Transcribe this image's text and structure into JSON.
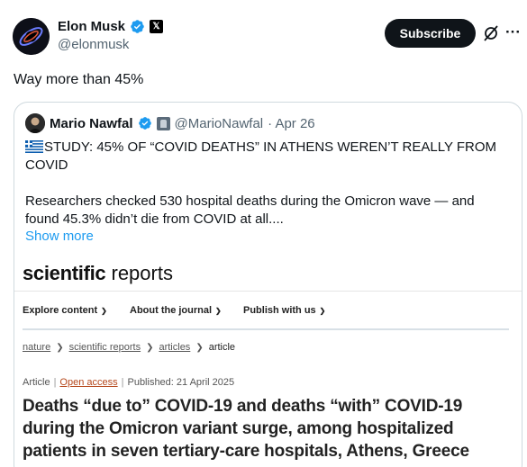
{
  "author": {
    "display_name": "Elon Musk",
    "handle": "@elonmusk"
  },
  "actions": {
    "subscribe_label": "Subscribe",
    "more_label": "···"
  },
  "tweet": {
    "text": "Way more than 45%"
  },
  "quote": {
    "display_name": "Mario Nawfal",
    "handle": "@MarioNawfal",
    "date": "· Apr 26",
    "headline": "STUDY: 45% OF “COVID DEATHS” IN ATHENS WEREN’T REALLY FROM COVID",
    "body": "Researchers checked 530 hospital deaths during the Omicron wave — and found 45.3% didn’t die from COVID at all....",
    "show_more": "Show more"
  },
  "embedded_page": {
    "logo_bold": "scientific",
    "logo_regular": "reports",
    "nav": [
      {
        "label": "Explore content"
      },
      {
        "label": "About the journal"
      },
      {
        "label": "Publish with us"
      }
    ],
    "breadcrumbs": [
      "nature",
      "scientific reports",
      "articles",
      "article"
    ],
    "meta": {
      "type": "Article",
      "access": "Open access",
      "published": "Published: 21 April 2025"
    },
    "title": "Deaths “due to” COVID-19 and deaths “with” COVID-19 during the Omicron variant surge, among hospitalized patients in seven tertiary-care hospitals, Athens, Greece"
  },
  "colors": {
    "accent": "#1d9bf0",
    "verified": "#1d9bf0",
    "open_access": "#b5471b"
  }
}
